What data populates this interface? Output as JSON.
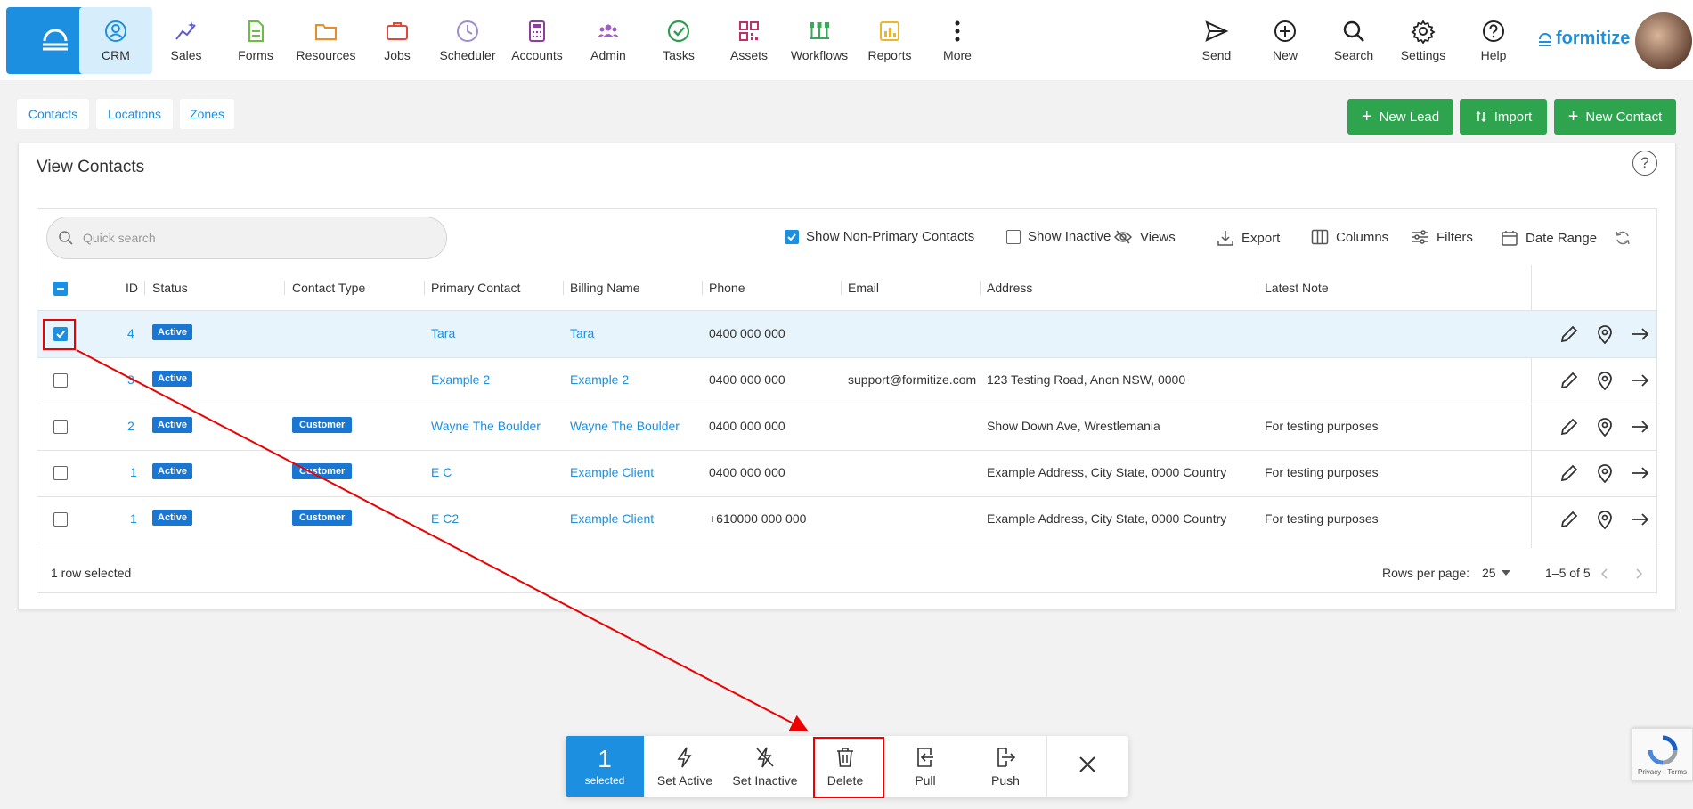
{
  "nav": {
    "items": [
      {
        "label": "CRM",
        "icon": "person-circle-icon"
      },
      {
        "label": "Sales",
        "icon": "sparkle-chart-icon"
      },
      {
        "label": "Forms",
        "icon": "document-icon"
      },
      {
        "label": "Resources",
        "icon": "folder-icon"
      },
      {
        "label": "Jobs",
        "icon": "briefcase-icon"
      },
      {
        "label": "Scheduler",
        "icon": "clock-icon"
      },
      {
        "label": "Accounts",
        "icon": "calculator-icon"
      },
      {
        "label": "Admin",
        "icon": "people-icon"
      },
      {
        "label": "Tasks",
        "icon": "check-circle-icon"
      },
      {
        "label": "Assets",
        "icon": "qr-code-icon"
      },
      {
        "label": "Workflows",
        "icon": "workflow-icon"
      },
      {
        "label": "Reports",
        "icon": "bar-chart-icon"
      },
      {
        "label": "More",
        "icon": "more-vertical-icon"
      }
    ],
    "right": [
      {
        "label": "Send",
        "icon": "send-icon"
      },
      {
        "label": "New",
        "icon": "plus-circle-icon"
      },
      {
        "label": "Search",
        "icon": "search-icon"
      },
      {
        "label": "Settings",
        "icon": "gear-icon"
      },
      {
        "label": "Help",
        "icon": "help-circle-icon"
      }
    ],
    "logo_text": "formitize"
  },
  "subtabs": [
    "Contacts",
    "Locations",
    "Zones"
  ],
  "buttons": {
    "new_lead": "New Lead",
    "import": "Import",
    "new_contact": "New Contact"
  },
  "card": {
    "title": "View Contacts"
  },
  "search": {
    "placeholder": "Quick search"
  },
  "toolbar": {
    "show_non_primary": "Show Non-Primary Contacts",
    "show_non_primary_checked": true,
    "show_inactive": "Show Inactive",
    "show_inactive_checked": false,
    "views": "Views",
    "export": "Export",
    "columns": "Columns",
    "filters": "Filters",
    "date_range": "Date Range"
  },
  "table": {
    "headers": [
      "ID",
      "Status",
      "Contact Type",
      "Primary Contact",
      "Billing Name",
      "Phone",
      "Email",
      "Address",
      "Latest Note"
    ],
    "rows": [
      {
        "id": "4",
        "status": "Active",
        "type": "",
        "primary": "Tara",
        "billing": "Tara",
        "phone": "0400 000 000",
        "email": "",
        "address": "",
        "note": "",
        "selected": true
      },
      {
        "id": "3",
        "status": "Active",
        "type": "",
        "primary": "Example 2",
        "billing": "Example 2",
        "phone": "0400 000 000",
        "email": "support@formitize.com",
        "address": "123 Testing Road, Anon NSW, 0000",
        "note": "",
        "selected": false
      },
      {
        "id": "2",
        "status": "Active",
        "type": "Customer",
        "primary": "Wayne The Boulder",
        "billing": "Wayne The Boulder",
        "phone": "0400 000 000",
        "email": "",
        "address": "Show Down Ave, Wrestlemania",
        "note": "For testing purposes",
        "selected": false
      },
      {
        "id": "1",
        "status": "Active",
        "type": "Customer",
        "primary": "E C",
        "billing": "Example Client",
        "phone": "0400 000 000",
        "email": "",
        "address": "Example Address, City State, 0000 Country",
        "note": "For testing purposes",
        "selected": false
      },
      {
        "id": "1",
        "status": "Active",
        "type": "Customer",
        "primary": "E C2",
        "billing": "Example Client",
        "phone": "+610000 000 000",
        "email": "",
        "address": "Example Address, City State, 0000 Country",
        "note": "For testing purposes",
        "selected": false
      }
    ]
  },
  "footer": {
    "selected_text": "1 row selected",
    "rows_per_page_label": "Rows per page:",
    "rows_per_page": "25",
    "range": "1–5 of 5"
  },
  "actionbar": {
    "count": "1",
    "count_label": "selected",
    "set_active": "Set Active",
    "set_inactive": "Set Inactive",
    "delete": "Delete",
    "pull": "Pull",
    "push": "Push"
  },
  "recaptcha": {
    "text": "Privacy - Terms"
  },
  "colors": {
    "primary": "#1c8fe0",
    "green": "#2ea44f",
    "badge": "#1976d2",
    "annotation": "#e00000"
  }
}
